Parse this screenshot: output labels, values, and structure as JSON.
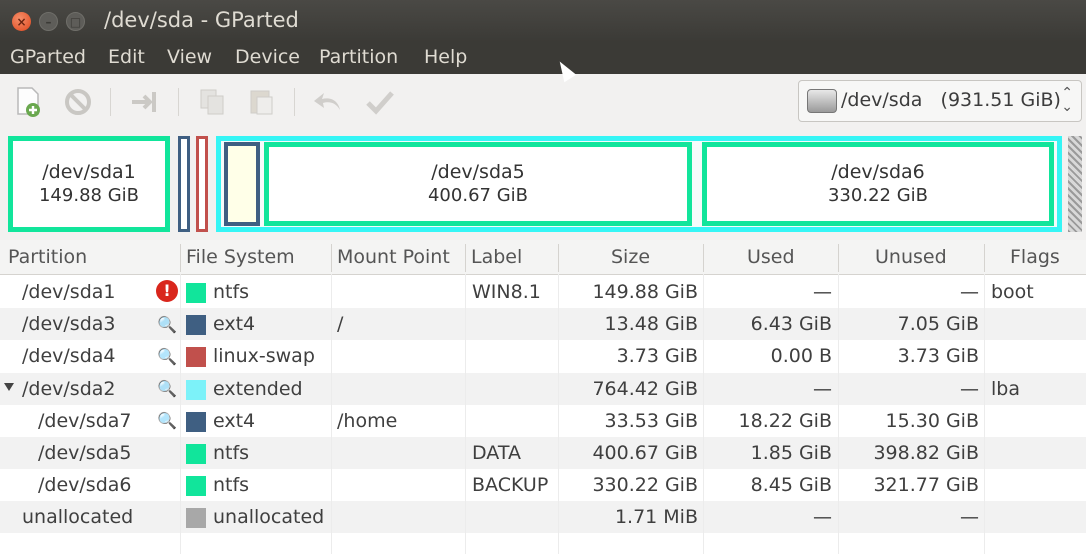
{
  "window": {
    "title": "/dev/sda - GParted"
  },
  "menu": [
    "GParted",
    "Edit",
    "View",
    "Device",
    "Partition",
    "Help"
  ],
  "toolbar": {
    "buttons": [
      "new-partition-icon",
      "delete-icon",
      "resize-move-icon",
      "copy-icon",
      "paste-icon",
      "undo-icon",
      "apply-icon"
    ]
  },
  "device_selector": {
    "device": "/dev/sda",
    "size": "(931.51 GiB)"
  },
  "partition_map": {
    "sda1": {
      "name": "/dev/sda1",
      "size": "149.88 GiB",
      "color": "#11e59b"
    },
    "sda5": {
      "name": "/dev/sda5",
      "size": "400.67 GiB",
      "color": "#11e59b"
    },
    "sda6": {
      "name": "/dev/sda6",
      "size": "330.22 GiB",
      "color": "#11e59b"
    },
    "extended_color": "#35f5f5",
    "ext4_color": "#3f5f82",
    "swap_color": "#c1504c"
  },
  "table": {
    "headers": [
      "Partition",
      "File System",
      "Mount Point",
      "Label",
      "Size",
      "Used",
      "Unused",
      "Flags"
    ],
    "rows": [
      {
        "partition": "/dev/sda1",
        "fs": "ntfs",
        "fs_color": "#11e59b",
        "mount": "",
        "label": "WIN8.1",
        "size": "149.88 GiB",
        "used": "—",
        "unused": "—",
        "flags": "boot",
        "status": "warning-icon"
      },
      {
        "partition": "/dev/sda3",
        "fs": "ext4",
        "fs_color": "#3f5f82",
        "mount": "/",
        "label": "",
        "size": "13.48 GiB",
        "used": "6.43 GiB",
        "unused": "7.05 GiB",
        "flags": "",
        "status": "key-icon"
      },
      {
        "partition": "/dev/sda4",
        "fs": "linux-swap",
        "fs_color": "#c1504c",
        "mount": "",
        "label": "",
        "size": "3.73 GiB",
        "used": "0.00 B",
        "unused": "3.73 GiB",
        "flags": "",
        "status": "key-icon"
      },
      {
        "partition": "/dev/sda2",
        "fs": "extended",
        "fs_color": "#7cf2f9",
        "mount": "",
        "label": "",
        "size": "764.42 GiB",
        "used": "—",
        "unused": "—",
        "flags": "lba",
        "status": "key-icon"
      },
      {
        "partition": "/dev/sda7",
        "fs": "ext4",
        "fs_color": "#3f5f82",
        "mount": "/home",
        "label": "",
        "size": "33.53 GiB",
        "used": "18.22 GiB",
        "unused": "15.30 GiB",
        "flags": "",
        "status": "key-icon"
      },
      {
        "partition": "/dev/sda5",
        "fs": "ntfs",
        "fs_color": "#11e59b",
        "mount": "",
        "label": "DATA",
        "size": "400.67 GiB",
        "used": "1.85 GiB",
        "unused": "398.82 GiB",
        "flags": "",
        "status": ""
      },
      {
        "partition": "/dev/sda6",
        "fs": "ntfs",
        "fs_color": "#11e59b",
        "mount": "",
        "label": "BACKUP",
        "size": "330.22 GiB",
        "used": "8.45 GiB",
        "unused": "321.77 GiB",
        "flags": "",
        "status": ""
      },
      {
        "partition": "unallocated",
        "fs": "unallocated",
        "fs_color": "#a8a8a8",
        "mount": "",
        "label": "",
        "size": "1.71 MiB",
        "used": "—",
        "unused": "—",
        "flags": "",
        "status": ""
      }
    ]
  }
}
